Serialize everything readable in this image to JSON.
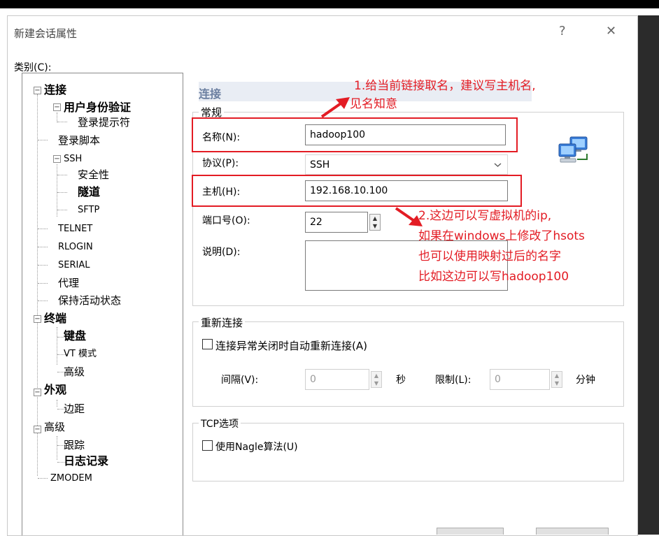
{
  "dialog": {
    "title": "新建会话属性",
    "help_label": "?",
    "close_label": "✕"
  },
  "category_label": "类别(C):",
  "tree": {
    "connection": "连接",
    "user_auth": "用户身份验证",
    "login_prompts": "登录提示符",
    "login_script": "登录脚本",
    "ssh": "SSH",
    "security": "安全性",
    "tunnel": "隧道",
    "sftp": "SFTP",
    "telnet": "TELNET",
    "rlogin": "RLOGIN",
    "serial": "SERIAL",
    "proxy": "代理",
    "keepalive": "保持活动状态",
    "terminal": "终端",
    "keyboard": "键盘",
    "vt_mode": "VT 模式",
    "terminal_advanced": "高级",
    "appearance": "外观",
    "margins": "边距",
    "advanced": "高级",
    "trace": "跟踪",
    "logging": "日志记录",
    "zmodem": "ZMODEM"
  },
  "panel": {
    "section_title": "连接",
    "general": {
      "title": "常规",
      "name_label": "名称(N):",
      "name_value": "hadoop100",
      "protocol_label": "协议(P):",
      "protocol_value": "SSH",
      "host_label": "主机(H):",
      "host_value": "192.168.10.100",
      "port_label": "端口号(O):",
      "port_value": "22",
      "desc_label": "说明(D):",
      "desc_value": ""
    },
    "reconnect": {
      "title": "重新连接",
      "auto_label": "连接异常关闭时自动重新连接(A)",
      "interval_label": "间隔(V):",
      "interval_value": "0",
      "interval_unit": "秒",
      "limit_label": "限制(L):",
      "limit_value": "0",
      "limit_unit": "分钟"
    },
    "tcp": {
      "title": "TCP选项",
      "nagle_label": "使用Nagle算法(U)"
    }
  },
  "annotations": {
    "note1_line1": "1.给当前链接取名，建议写主机名,",
    "note1_line2": "见名知意",
    "note2_line1": "2.这边可以写虚拟机的ip,",
    "note2_line2": "如果在windows上修改了hsots",
    "note2_line3": "也可以使用映射过后的名字",
    "note2_line4": "比如这边可以写hadoop100",
    "color": "#e31c24"
  },
  "icons": {
    "network": "network-computers-icon",
    "dropdown": "chevron-down-icon"
  }
}
